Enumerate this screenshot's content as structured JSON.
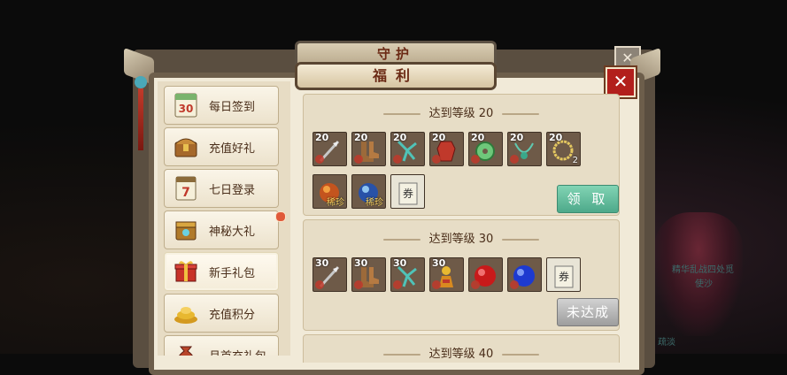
{
  "window": {
    "back_title": "守护",
    "title": "福利",
    "close_back_glyph": "✕",
    "close_glyph": "✕"
  },
  "sidebar": {
    "items": [
      {
        "label": "每日签到",
        "icon": "calendar-30-icon",
        "icon_text": "30"
      },
      {
        "label": "充值好礼",
        "icon": "treasure-chest-icon"
      },
      {
        "label": "七日登录",
        "icon": "calendar-7-icon",
        "icon_text": "7"
      },
      {
        "label": "神秘大礼",
        "icon": "mystery-box-icon",
        "badge": true
      },
      {
        "label": "新手礼包",
        "icon": "gift-box-icon",
        "active": true
      },
      {
        "label": "充值积分",
        "icon": "gold-pile-icon"
      },
      {
        "label": "月首充礼包",
        "icon": "money-bag-icon"
      }
    ]
  },
  "cards": [
    {
      "title": "达到等级 20",
      "rows": [
        [
          {
            "level": "20",
            "icon": "spear-icon"
          },
          {
            "level": "20",
            "icon": "boots-icon"
          },
          {
            "level": "20",
            "icon": "jade-pendant-icon"
          },
          {
            "level": "20",
            "icon": "red-armor-icon"
          },
          {
            "level": "20",
            "icon": "jade-disc-icon"
          },
          {
            "level": "20",
            "icon": "necklace-icon"
          },
          {
            "level": "20",
            "icon": "gold-ring-icon",
            "count": "2"
          }
        ],
        [
          {
            "level": "",
            "icon": "fire-orb-icon",
            "tag": "稀珍"
          },
          {
            "level": "",
            "icon": "blue-orb-icon",
            "tag": "稀珍"
          },
          {
            "level": "",
            "icon": "scroll-icon",
            "tag": "券"
          }
        ]
      ],
      "button": {
        "label": "领 取",
        "state": "claimable",
        "color": "#4da98a"
      }
    },
    {
      "title": "达到等级 30",
      "rows": [
        [
          {
            "level": "30",
            "icon": "spear-icon"
          },
          {
            "level": "30",
            "icon": "boots-icon"
          },
          {
            "level": "30",
            "icon": "jade-pendant-icon"
          },
          {
            "level": "30",
            "icon": "golden-figure-icon"
          },
          {
            "level": "",
            "icon": "red-orb-icon"
          },
          {
            "level": "",
            "icon": "blue-sphere-icon"
          },
          {
            "level": "",
            "icon": "scroll-icon",
            "tag": "券"
          }
        ]
      ],
      "button": {
        "label": "未达成",
        "state": "locked",
        "color": "#9d9d9d"
      }
    },
    {
      "title": "达到等级 40"
    }
  ],
  "background": {
    "chat_lines": [
      "精华乱战四处觅",
      "使沙",
      "疏淡"
    ]
  }
}
